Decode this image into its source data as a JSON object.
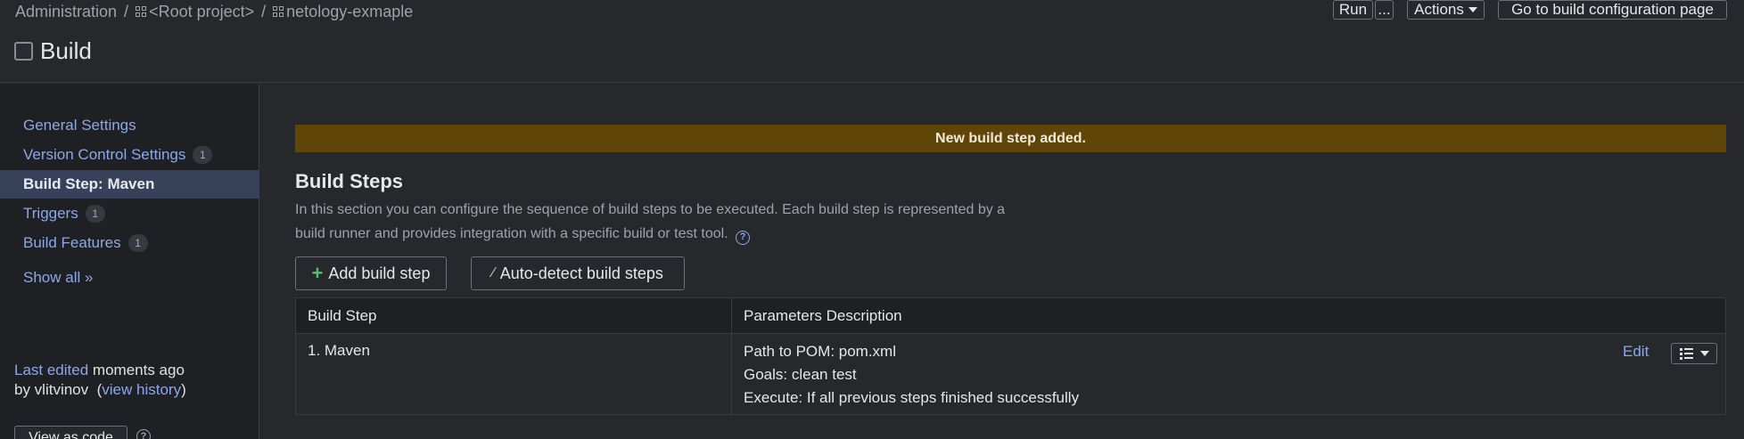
{
  "breadcrumb": {
    "items": [
      "Administration",
      "<Root project>",
      "netology-exmaple"
    ],
    "separator": "/"
  },
  "header": {
    "title": "Build",
    "run_label": "Run",
    "more_label": "...",
    "actions_label": "Actions",
    "goto_label": "Go to build configuration page"
  },
  "sidebar": {
    "items": [
      {
        "label": "General Settings",
        "count": ""
      },
      {
        "label": "Version Control Settings",
        "count": "1"
      },
      {
        "label": "Build Step: Maven",
        "count": ""
      },
      {
        "label": "Triggers",
        "count": "1"
      },
      {
        "label": "Build Features",
        "count": "1"
      }
    ],
    "show_all": "Show all »",
    "last_edited": {
      "link": "Last edited",
      "time": "moments ago",
      "by": "by vlitvinov",
      "history_link": "view history"
    },
    "view_code_label": "View as code"
  },
  "main": {
    "notice": "New build step added.",
    "section_title": "Build Steps",
    "description_line1": "In this section you can configure the sequence of build steps to be executed. Each build step is represented by a",
    "description_line2": "build runner and provides integration with a specific build or test tool.",
    "add_step_label": "Add build step",
    "auto_detect_label": "Auto-detect build steps",
    "table": {
      "headers": [
        "Build Step",
        "Parameters Description"
      ],
      "rows": [
        {
          "step": "1. Maven",
          "params": [
            "Path to POM: pom.xml",
            "Goals: clean test",
            "Execute: If all previous steps finished successfully"
          ],
          "edit_label": "Edit"
        }
      ]
    }
  },
  "colors": {
    "background": "#27282c",
    "sidebar": "#1f2023",
    "accent_link": "#8ba8e8",
    "notice_bg": "#5f4507",
    "active_item": "#37415a",
    "add_icon": "#4cc36a"
  },
  "icons": [
    "grid-icon",
    "checkbox-icon",
    "caret-down-icon",
    "help-icon",
    "plus-icon",
    "magic-wand-icon",
    "list-icon"
  ]
}
